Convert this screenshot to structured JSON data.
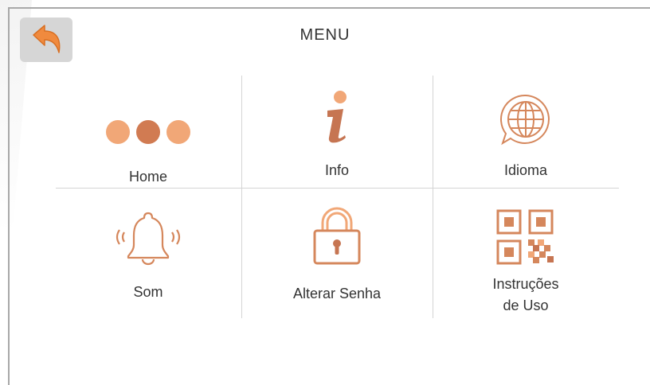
{
  "header": {
    "title": "MENU",
    "back_icon": "back-arrow-icon"
  },
  "colors": {
    "accent": "#d5875c",
    "accent_light": "#f1a777",
    "accent_dark": "#c07552",
    "back_bg": "#d6d6d6",
    "grid": "#d4d4d4"
  },
  "menu": {
    "items": [
      {
        "label": "Home",
        "icon": "three-dots-icon"
      },
      {
        "label": "Info",
        "icon": "info-icon"
      },
      {
        "label": "Idioma",
        "icon": "globe-chat-icon"
      },
      {
        "label": "Som",
        "icon": "bell-ringing-icon"
      },
      {
        "label": "Alterar Senha",
        "icon": "lock-icon"
      },
      {
        "label": "Instruções\nde Uso",
        "icon": "qr-code-icon"
      }
    ]
  }
}
